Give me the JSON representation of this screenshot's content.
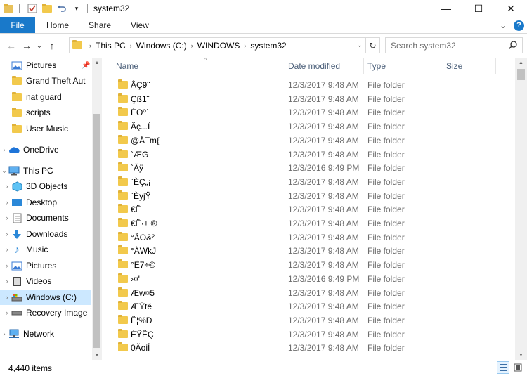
{
  "window": {
    "title": "system32",
    "minimize": "—",
    "maximize": "☐",
    "close": "✕"
  },
  "ribbon": {
    "file": "File",
    "tabs": [
      "Home",
      "Share",
      "View"
    ],
    "expand": "⌄",
    "help": "?"
  },
  "address": {
    "back": "←",
    "forward": "→",
    "recent": "⌄",
    "up": "↑",
    "crumbs": [
      "This PC",
      "Windows (C:)",
      "WINDOWS",
      "system32"
    ],
    "separator": "›",
    "dropdown": "⌄",
    "refresh": "↻"
  },
  "search": {
    "placeholder": "Search system32"
  },
  "nav": {
    "quick": [
      {
        "label": "Pictures",
        "icon": "pictures-icon",
        "pinned": true
      },
      {
        "label": "Grand Theft Aut",
        "icon": "folder-icon"
      },
      {
        "label": "nat guard",
        "icon": "folder-icon"
      },
      {
        "label": "scripts",
        "icon": "folder-icon"
      },
      {
        "label": "User Music",
        "icon": "folder-icon"
      }
    ],
    "onedrive": "OneDrive",
    "thispc": "This PC",
    "pc_items": [
      {
        "label": "3D Objects",
        "icon": "3d-objects-icon"
      },
      {
        "label": "Desktop",
        "icon": "desktop-icon"
      },
      {
        "label": "Documents",
        "icon": "documents-icon"
      },
      {
        "label": "Downloads",
        "icon": "downloads-icon"
      },
      {
        "label": "Music",
        "icon": "music-icon"
      },
      {
        "label": "Pictures",
        "icon": "pictures-icon"
      },
      {
        "label": "Videos",
        "icon": "videos-icon"
      },
      {
        "label": "Windows (C:)",
        "icon": "drive-icon",
        "selected": true
      },
      {
        "label": "Recovery Image",
        "icon": "drive-icon"
      }
    ],
    "network": "Network"
  },
  "columns": {
    "name": "Name",
    "date": "Date modified",
    "type": "Type",
    "size": "Size"
  },
  "files": [
    {
      "name": "ÂÇ9¨",
      "date": "12/3/2017 9:48 AM",
      "type": "File folder"
    },
    {
      "name": "Çß1¨",
      "date": "12/3/2017 9:48 AM",
      "type": "File folder"
    },
    {
      "name": "ÉOº´",
      "date": "12/3/2017 9:48 AM",
      "type": "File folder"
    },
    {
      "name": "Äç...Ï",
      "date": "12/3/2017 9:48 AM",
      "type": "File folder"
    },
    {
      "name": "@Å¯m{",
      "date": "12/3/2017 9:48 AM",
      "type": "File folder"
    },
    {
      "name": "`ÆG",
      "date": "12/3/2017 9:48 AM",
      "type": "File folder"
    },
    {
      "name": "`Äÿ",
      "date": "12/3/2016 9:49 PM",
      "type": "File folder"
    },
    {
      "name": "`ÈÇ„¡",
      "date": "12/3/2017 9:48 AM",
      "type": "File folder"
    },
    {
      "name": "`ÈyjŸ",
      "date": "12/3/2017 9:48 AM",
      "type": "File folder"
    },
    {
      "name": "€Ë",
      "date": "12/3/2017 9:48 AM",
      "type": "File folder"
    },
    {
      "name": "€Ë·± ®",
      "date": "12/3/2017 9:48 AM",
      "type": "File folder"
    },
    {
      "name": "°ÂO&²",
      "date": "12/3/2017 9:48 AM",
      "type": "File folder"
    },
    {
      "name": "°ÃWkJ",
      "date": "12/3/2017 9:48 AM",
      "type": "File folder"
    },
    {
      "name": "°Ë7÷©",
      "date": "12/3/2017 9:48 AM",
      "type": "File folder"
    },
    {
      "name": "›¤'",
      "date": "12/3/2016 9:49 PM",
      "type": "File folder"
    },
    {
      "name": "Æw¤5",
      "date": "12/3/2017 9:48 AM",
      "type": "File folder"
    },
    {
      "name": "ÆŸté",
      "date": "12/3/2017 9:48 AM",
      "type": "File folder"
    },
    {
      "name": "Ë¦%Ð",
      "date": "12/3/2017 9:48 AM",
      "type": "File folder"
    },
    {
      "name": "ÈŸËÇ",
      "date": "12/3/2017 9:48 AM",
      "type": "File folder"
    },
    {
      "name": "0ÃoiÎ",
      "date": "12/3/2017 9:48 AM",
      "type": "File folder"
    }
  ],
  "status": {
    "count": "4,440 items"
  },
  "colors": {
    "accent": "#1979ca",
    "selected": "#cce8ff",
    "folder": "#f2c94c"
  }
}
